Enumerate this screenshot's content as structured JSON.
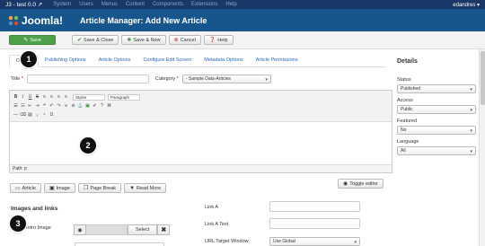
{
  "topnav": {
    "site": "J3 - test 0.0 ↗",
    "menu": [
      "System",
      "Users",
      "Menus",
      "Content",
      "Components",
      "Extensions",
      "Help"
    ],
    "user": "edandres ▾"
  },
  "header": {
    "logo_text": "Joomla!",
    "title": "Article Manager: Add New Article"
  },
  "toolbar": {
    "save": "Save",
    "save_close": "Save & Close",
    "save_new": "Save & New",
    "cancel": "Cancel",
    "help": "Help"
  },
  "tabs": [
    "Details",
    "Publishing Options",
    "Article Options",
    "Configure Edit Screen",
    "Metadata Options",
    "Article Permissions"
  ],
  "form": {
    "title_label": "Title",
    "required_mark": "*",
    "category_label": "Category",
    "category_value": "- Sample Data-Articles"
  },
  "editor": {
    "styles": "Styles",
    "paragraph": "Paragraph",
    "status_path": "Path: p"
  },
  "editor_buttons": [
    "Article",
    "Image",
    "Page Break",
    "Read More"
  ],
  "toggle_editor": "Toggle editor",
  "images": {
    "section_title": "Images and links",
    "intro_label": "Intro Image",
    "select": "Select",
    "clear": "✖"
  },
  "links": {
    "link_a": "Link A",
    "link_a_text": "Link A Text",
    "url_target": "URL Target Window",
    "url_target_value": "Use Global"
  },
  "sidebar": {
    "title": "Details",
    "fields": [
      {
        "label": "Status",
        "value": "Published"
      },
      {
        "label": "Access",
        "value": "Public"
      },
      {
        "label": "Featured",
        "value": "No"
      },
      {
        "label": "Language",
        "value": "All"
      }
    ]
  },
  "callouts": [
    "1",
    "2",
    "3"
  ],
  "colors": {
    "topnav": "#1a3867",
    "header": "#17568c",
    "save_green": "#4fa04a",
    "link_blue": "#2a69b8"
  }
}
